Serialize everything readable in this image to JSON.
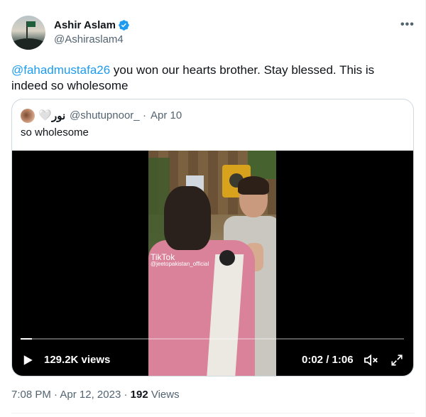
{
  "author": {
    "name": "Ashir Aslam",
    "handle": "@Ashiraslam4",
    "verified": true,
    "more_icon": "more-horizontal-icon"
  },
  "tweet": {
    "mention": "@fahadmustafa26",
    "text": " you won our hearts brother. Stay blessed. This is indeed so wholesome"
  },
  "quoted": {
    "heart_glyph": "🤍",
    "name": "نور",
    "handle": "@shutupnoor_",
    "separator": "·",
    "date": "Apr 10",
    "text": "so wholesome",
    "video": {
      "watermark_logo": "TikTok",
      "watermark_handle": "@jeetopakistan_official",
      "progress": 0.03,
      "views": "129.2K views",
      "time": "0:02 / 1:06"
    }
  },
  "meta": {
    "time": "7:08 PM",
    "dot1": " · ",
    "date": "Apr 12, 2023",
    "dot2": " · ",
    "views_count": "192",
    "views_label": " Views"
  },
  "colors": {
    "accent": "#1d9bf0",
    "muted": "#536471",
    "text": "#0f1419",
    "border": "#cfd9de"
  }
}
